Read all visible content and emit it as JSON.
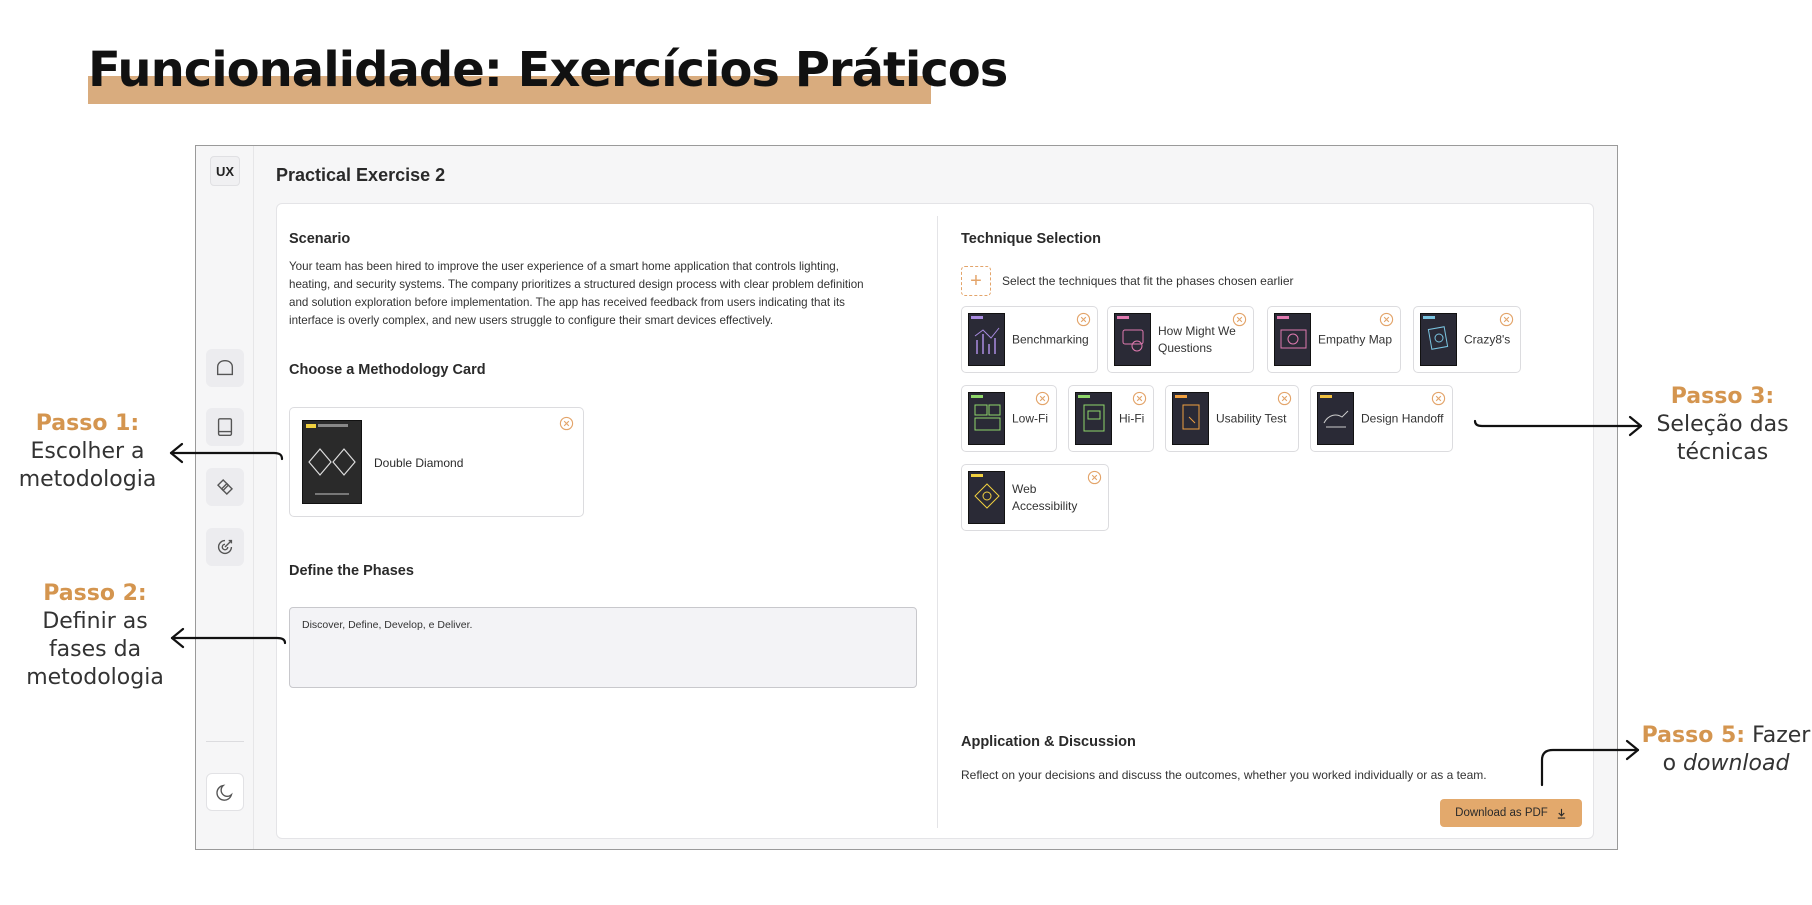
{
  "slide": {
    "title": "Funcionalidade: Exercícios Práticos"
  },
  "app": {
    "logo": "UX",
    "page_title": "Practical Exercise 2",
    "sidebar": {
      "items": [
        {
          "icon": "home-icon"
        },
        {
          "icon": "book-icon"
        },
        {
          "icon": "cards-icon"
        },
        {
          "icon": "target-icon"
        }
      ],
      "theme_toggle_icon": "moon-icon"
    },
    "scenario": {
      "heading": "Scenario",
      "lines": [
        "Your team has been hired to improve the user experience of a smart home application that controls lighting,",
        "heating, and security systems. The company prioritizes a structured design process with clear problem definition",
        "and solution exploration before implementation. The app has received feedback from users indicating that its",
        "interface is overly complex, and new users struggle to configure their smart devices effectively."
      ]
    },
    "methodology": {
      "heading": "Choose a Methodology Card",
      "card_label": "Double Diamond"
    },
    "phases": {
      "heading": "Define the Phases",
      "value": "Discover, Define, Develop, e Deliver."
    },
    "techniques": {
      "heading": "Technique Selection",
      "hint": "Select the techniques that fit the phases chosen earlier",
      "cards": [
        {
          "label": "Benchmarking",
          "tag_color": "#a98be0"
        },
        {
          "label": "How Might We Questions",
          "tag_color": "#e07ab0"
        },
        {
          "label": "Empathy Map",
          "tag_color": "#e07ab0"
        },
        {
          "label": "Crazy8's",
          "tag_color": "#7ac4e0"
        },
        {
          "label": "Low-Fi",
          "tag_color": "#8fd66a"
        },
        {
          "label": "Hi-Fi",
          "tag_color": "#8fd66a"
        },
        {
          "label": "Usability Test",
          "tag_color": "#f0a040"
        },
        {
          "label": "Design Handoff",
          "tag_color": "#f0c040"
        },
        {
          "label": "Web Accessibility",
          "tag_color": "#f0d040"
        }
      ]
    },
    "application": {
      "heading": "Application & Discussion",
      "description": "Reflect on your decisions and discuss the outcomes, whether you worked individually or as a team.",
      "download_label": "Download as PDF"
    }
  },
  "annotations": {
    "step1": {
      "step": "Passo 1:",
      "lines": [
        "Escolher a",
        "metodologia"
      ]
    },
    "step2": {
      "step": "Passo 2:",
      "lines": [
        "Definir as",
        "fases da",
        "metodologia"
      ]
    },
    "step3": {
      "step": "Passo 3:",
      "lines": [
        "Seleção das",
        "técnicas"
      ]
    },
    "step5": {
      "step": "Passo 5:",
      "text_after": " Fazer",
      "line2_prefix": "o ",
      "line2_em": "download"
    }
  },
  "colors": {
    "accent": "#e3a96c",
    "title_highlight": "#d9ac7e",
    "annotation_step": "#d4954f"
  }
}
